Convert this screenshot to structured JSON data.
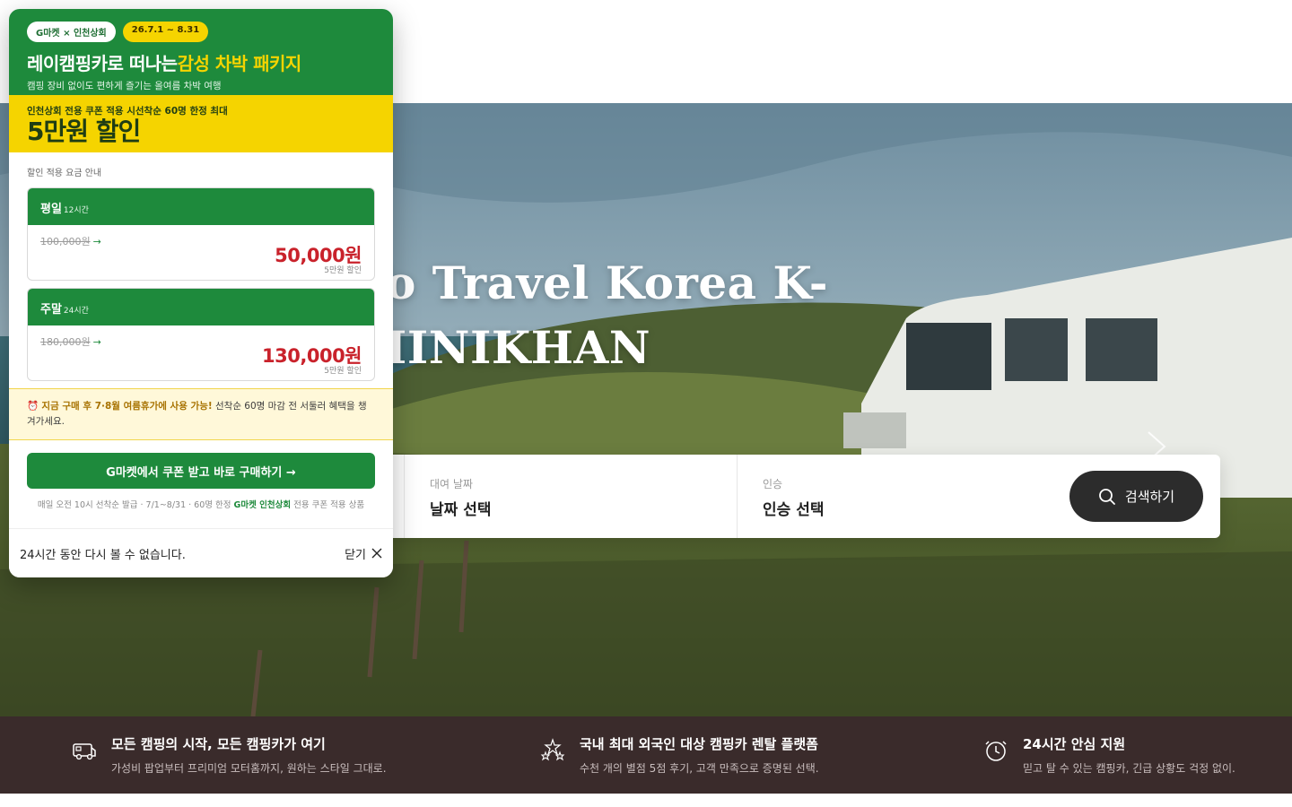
{
  "hero": {
    "title_line1": "To Travel Korea K-",
    "title_line2": "MINIKHAN"
  },
  "search": {
    "fields": [
      {
        "label": "",
        "value": ""
      },
      {
        "label": "대여 날짜",
        "value": "날짜 선택"
      },
      {
        "label": "인승",
        "value": "인승 선택"
      }
    ],
    "button_label": "검색하기"
  },
  "features": [
    {
      "icon": "camper-van-icon",
      "title": "모든 캠핑의 시작, 모든 캠핑카가 여기",
      "desc": "가성비 팝업부터 프리미엄 모터홈까지, 원하는 스타일 그대로."
    },
    {
      "icon": "stars-icon",
      "title": "국내 최대 외국인 대상 캠핑카 렌탈 플랫폼",
      "desc": "수천 개의 별점 5점 후기, 고객 만족으로 증명된 선택."
    },
    {
      "icon": "clock-icon",
      "title": "24시간 안심 지원",
      "desc": "믿고 탈 수 있는 캠핑카, 긴급 상황도 걱정 없이."
    }
  ],
  "popup": {
    "badge_brand": "G마켓 × 인천상회",
    "badge_date": "26.7.1 ~ 8.31",
    "title_main": "레이캠핑카로 떠나는",
    "title_highlight": "감성 차박 패키지",
    "subtitle": "캠핑 장비 없이도 편하게 즐기는 올여름 차박 여행",
    "yellow_sub": "인천상회 전용 쿠폰 적용 시선착순 60명 한정 최대",
    "yellow_big": "5만원 할인",
    "section_label": "할인 적용 요금 안내",
    "prices": [
      {
        "name": "평일",
        "duration": "12시간",
        "old": "100,000원",
        "new": "50,000원",
        "note": "5만원 할인"
      },
      {
        "name": "주말",
        "duration": "24시간",
        "old": "180,000원",
        "new": "130,000원",
        "note": "5만원 할인"
      }
    ],
    "alert_icon": "⏰",
    "alert_strong": "지금 구매 후 7·8월 여름휴가에 사용 가능!",
    "alert_rest": " 선착순 60명 마감 전 서둘러 혜택을 챙겨가세요.",
    "cta_label": "G마켓에서 쿠폰 받고 바로 구매하기 →",
    "cta_note_pre": "매일 오전 10시 선착순 발급 · 7/1~8/31 · 60명 한정 ",
    "cta_note_brand": "G마켓 인천상회",
    "cta_note_post": " 전용 쿠폰 적용 상품",
    "dont_show": "24시간 동안 다시 볼 수 없습니다.",
    "close_label": "닫기"
  },
  "colors": {
    "brand_green": "#1e8a3c",
    "accent_yellow": "#f5d400",
    "price_red": "#c9222b",
    "footer_strip": "#3a2b2b"
  }
}
